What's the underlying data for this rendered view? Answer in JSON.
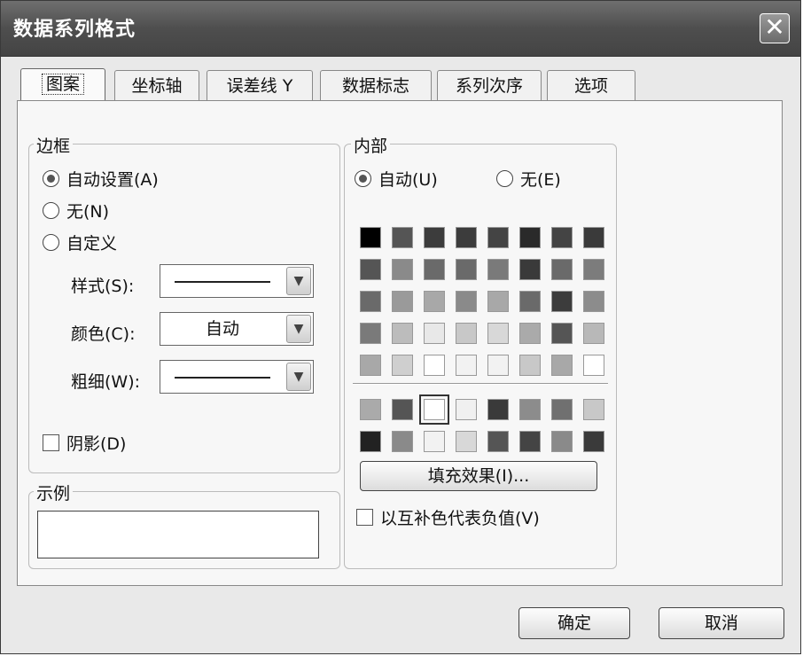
{
  "dialog": {
    "title": "数据系列格式",
    "close_glyph": "✕"
  },
  "tabs": [
    {
      "label": "图案",
      "active": true
    },
    {
      "label": "坐标轴",
      "active": false
    },
    {
      "label": "误差线 Y",
      "active": false
    },
    {
      "label": "数据标志",
      "active": false
    },
    {
      "label": "系列次序",
      "active": false
    },
    {
      "label": "选项",
      "active": false
    }
  ],
  "border": {
    "legend": "边框",
    "auto_label": "自动设置(A)",
    "none_label": "无(N)",
    "custom_label": "自定义",
    "selected": "auto",
    "style_label": "样式(S):",
    "color_label": "颜色(C):",
    "color_value": "自动",
    "weight_label": "粗细(W):",
    "shadow_label": "阴影(D)",
    "shadow_checked": false
  },
  "sample": {
    "legend": "示例"
  },
  "area": {
    "legend": "内部",
    "auto_label": "自动(U)",
    "none_label": "无(E)",
    "selected": "auto",
    "palette_main": [
      [
        "#000000",
        "#555555",
        "#3c3c3c",
        "#3c3c3c",
        "#444444",
        "#2a2a2a",
        "#444444",
        "#3a3a3a"
      ],
      [
        "#555555",
        "#8a8a8a",
        "#6a6a6a",
        "#6a6a6a",
        "#7a7a7a",
        "#3a3a3a",
        "#6a6a6a",
        "#7c7c7c"
      ],
      [
        "#6a6a6a",
        "#9a9a9a",
        "#a8a8a8",
        "#8a8a8a",
        "#a8a8a8",
        "#6a6a6a",
        "#3c3c3c",
        "#8c8c8c"
      ],
      [
        "#7a7a7a",
        "#bcbcbc",
        "#e8e8e8",
        "#c8c8c8",
        "#d8d8d8",
        "#aaaaaa",
        "#555555",
        "#b8b8b8"
      ],
      [
        "#a8a8a8",
        "#cfcfcf",
        "#ffffff",
        "#f2f2f2",
        "#f2f2f2",
        "#c8c8c8",
        "#a8a8a8",
        "#ffffff"
      ]
    ],
    "palette_extra": [
      [
        "#aaaaaa",
        "#555555",
        "#ffffff",
        "#f0f0f0",
        "#3a3a3a",
        "#8c8c8c",
        "#707070",
        "#c8c8c8"
      ],
      [
        "#222222",
        "#8a8a8a",
        "#f2f2f2",
        "#d8d8d8",
        "#555555",
        "#444444",
        "#8a8a8a",
        "#3a3a3a"
      ]
    ],
    "selected_extra": {
      "row": 0,
      "col": 2
    },
    "fill_effects_label": "填充效果(I)...",
    "invert_label": "以互补色代表负值(V)",
    "invert_checked": false
  },
  "buttons": {
    "ok_label": "确定",
    "cancel_label": "取消"
  }
}
